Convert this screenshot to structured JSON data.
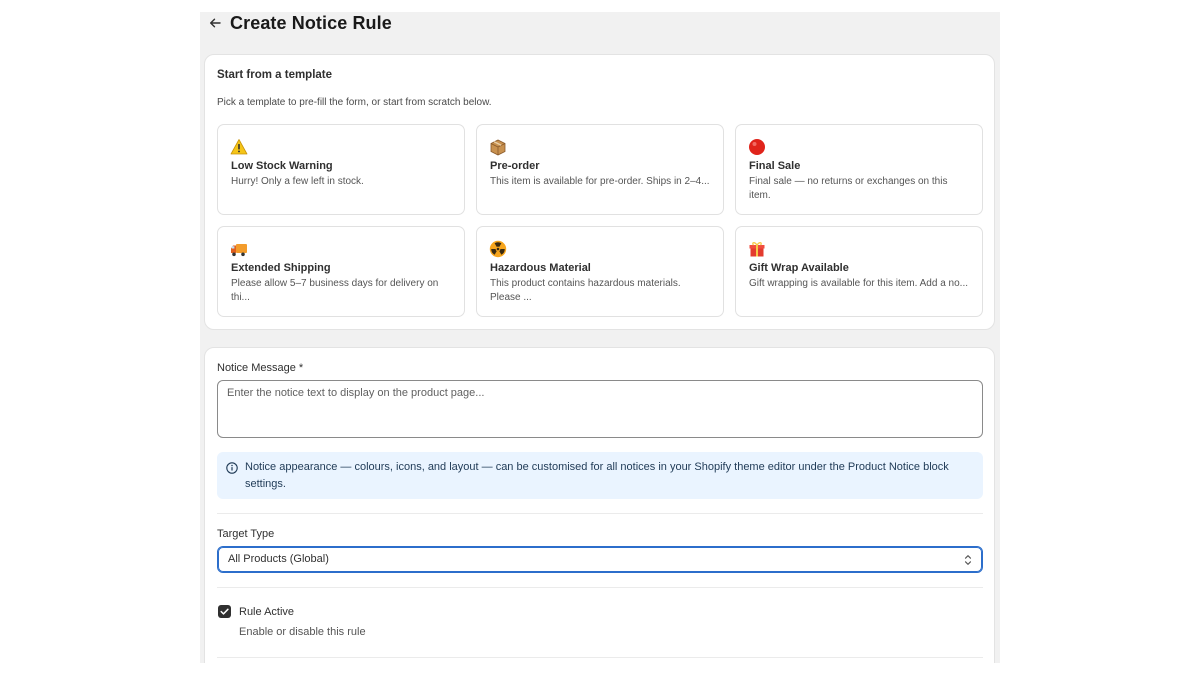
{
  "header": {
    "title": "Create Notice Rule",
    "back_icon": "arrow-left-icon"
  },
  "templates_section": {
    "title": "Start from a template",
    "subtitle": "Pick a template to pre-fill the form, or start from scratch below.",
    "items": [
      {
        "icon": "warning-icon",
        "name": "Low Stock Warning",
        "description": "Hurry! Only a few left in stock."
      },
      {
        "icon": "package-icon",
        "name": "Pre-order",
        "description": "This item is available for pre-order. Ships in 2–4..."
      },
      {
        "icon": "red-circle-icon",
        "name": "Final Sale",
        "description": "Final sale — no returns or exchanges on this item."
      },
      {
        "icon": "truck-icon",
        "name": "Extended Shipping",
        "description": "Please allow 5–7 business days for delivery on thi..."
      },
      {
        "icon": "radioactive-icon",
        "name": "Hazardous Material",
        "description": "This product contains hazardous materials. Please ..."
      },
      {
        "icon": "gift-icon",
        "name": "Gift Wrap Available",
        "description": "Gift wrapping is available for this item. Add a no..."
      }
    ]
  },
  "form": {
    "message_label": "Notice Message *",
    "message_placeholder": "Enter the notice text to display on the product page...",
    "message_value": "",
    "info_banner": "Notice appearance — colours, icons, and layout — can be customised for all notices in your Shopify theme editor under the Product Notice block settings.",
    "target_label": "Target Type",
    "target_value": "All Products (Global)",
    "rule_active_label": "Rule Active",
    "rule_active_help": "Enable or disable this rule",
    "rule_active_checked": true
  },
  "colors": {
    "accent": "#2c6ecb",
    "banner_bg": "#eaf4ff",
    "page_bg": "#f1f1f1"
  }
}
